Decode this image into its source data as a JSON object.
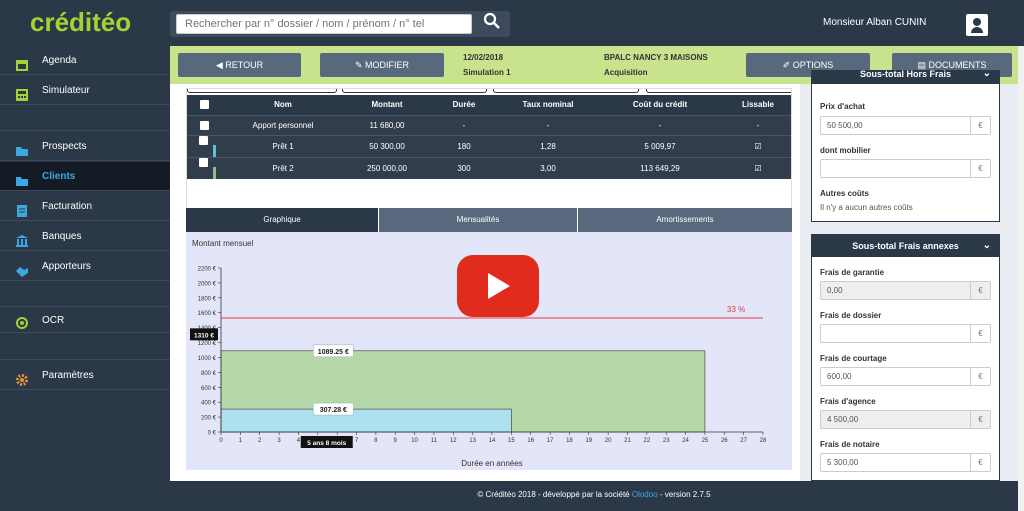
{
  "app": {
    "logo": "créditéo"
  },
  "search": {
    "placeholder": "Rechercher par n° dossier / nom / prénom / n° tel"
  },
  "user": {
    "name": "Monsieur Alban CUNIN"
  },
  "sidebar": {
    "items": [
      {
        "label": "Agenda",
        "icon": "calendar-icon"
      },
      {
        "label": "Simulateur",
        "icon": "calculator-icon"
      },
      {
        "label": "Prospects",
        "icon": "folder-icon"
      },
      {
        "label": "Clients",
        "icon": "folder-open-icon",
        "active": true
      },
      {
        "label": "Facturation",
        "icon": "invoice-icon"
      },
      {
        "label": "Banques",
        "icon": "bank-icon"
      },
      {
        "label": "Apporteurs",
        "icon": "handshake-icon"
      },
      {
        "label": "OCR",
        "icon": "target-icon"
      },
      {
        "label": "Paramètres",
        "icon": "gear-icon"
      }
    ]
  },
  "actionbar": {
    "retour": "RETOUR",
    "modifier": "MODIFIER",
    "date": "12/02/2018",
    "simulation": "Simulation 1",
    "bank": "BPALC NANCY 3 MAISONS",
    "type": "Acquisition",
    "options": "OPTIONS",
    "documents": "DOCUMENTS"
  },
  "loans": {
    "headers": [
      "Nom",
      "Montant",
      "Durée",
      "Taux nominal",
      "Coût du crédit",
      "Lissable"
    ],
    "rows": [
      {
        "nom": "Apport personnel",
        "montant": "11 680,00",
        "duree": "-",
        "taux": "-",
        "cout": "-",
        "lissable": "-",
        "color": ""
      },
      {
        "nom": "Prêt 1",
        "montant": "50 300,00",
        "duree": "180",
        "taux": "1,28",
        "cout": "5 009,97",
        "lissable": "check",
        "color": "#5bc0de"
      },
      {
        "nom": "Prêt 2",
        "montant": "250 000,00",
        "duree": "300",
        "taux": "3,00",
        "cout": "113 649,29",
        "lissable": "check",
        "color": "#8fbc8f"
      }
    ]
  },
  "tabs": {
    "graphique": "Graphique",
    "mensualites": "Mensualités",
    "amortissements": "Amortissements"
  },
  "chart_data": {
    "type": "area",
    "ylabel": "Montant mensuel",
    "xlabel": "Durée en années",
    "xlim": [
      0,
      28
    ],
    "ylim": [
      0,
      2200
    ],
    "y_ticks": [
      "0 €",
      "200 €",
      "400 €",
      "600 €",
      "800 €",
      "1000 €",
      "1200 €",
      "1400 €",
      "1600 €",
      "1800 €",
      "2000 €",
      "2200 €"
    ],
    "x_ticks": [
      "0",
      "1",
      "2",
      "3",
      "4",
      "5",
      "6",
      "7",
      "8",
      "9",
      "10",
      "11",
      "12",
      "13",
      "14",
      "15",
      "16",
      "17",
      "18",
      "19",
      "20",
      "21",
      "22",
      "23",
      "24",
      "25",
      "26",
      "27",
      "28"
    ],
    "series": [
      {
        "name": "Prêt 1",
        "value": 307.28,
        "x_end": 15,
        "color": "#aee1f0",
        "label": "307.28 €"
      },
      {
        "name": "Prêt 2",
        "value": 1089.25,
        "x_end": 25,
        "color": "#b6d7a8",
        "label": "1089.25 €"
      }
    ],
    "threshold": {
      "value": 1530,
      "label": "33 %",
      "color": "#e03a3a"
    },
    "y_marker": {
      "value": 1310,
      "label": "1310 €"
    },
    "x_marker": {
      "value": 5.67,
      "label": "5 ans 8 mois"
    }
  },
  "video": {
    "icon": "youtube-play-icon"
  },
  "right_panel_1": {
    "title": "Sous-total Hors Frais",
    "prix_achat_label": "Prix d'achat",
    "prix_achat": "50 500,00",
    "mobilier_label": "dont mobilier",
    "mobilier": "",
    "autres_label": "Autres coûts",
    "autres_note": "Il n'y a aucun autres coûts",
    "currency": "€"
  },
  "right_panel_2": {
    "title": "Sous-total Frais annexes",
    "garantie_label": "Frais de garantie",
    "garantie": "0,00",
    "dossier_label": "Frais de dossier",
    "dossier": "",
    "courtage_label": "Frais de courtage",
    "courtage": "600,00",
    "agence_label": "Frais d'agence",
    "agence": "4 500,00",
    "notaire_label": "Frais de notaire",
    "notaire": "5 300,00",
    "currency": "€"
  },
  "footer": {
    "prefix": "© Créditéo 2018 - développé par la société",
    "company": "Olodoo",
    "version": "- version 2.7.5"
  }
}
